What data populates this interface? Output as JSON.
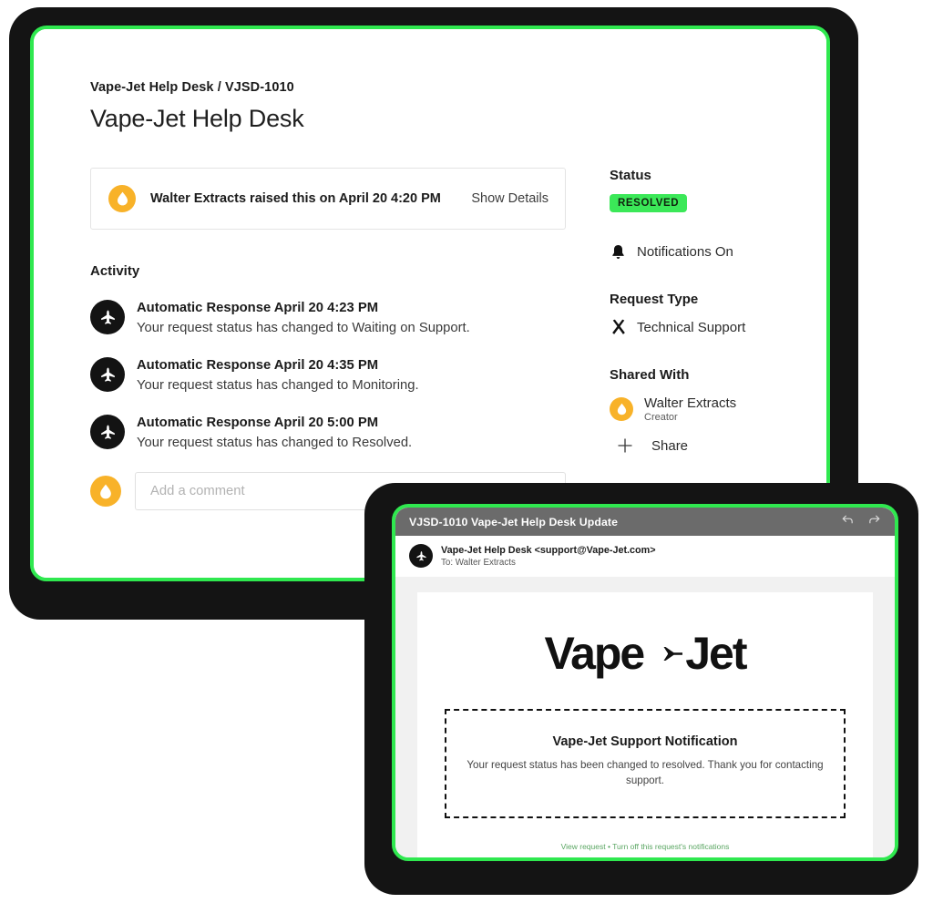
{
  "theme": {
    "accent_green": "#2FE84F",
    "badge_green": "#3BE858",
    "avatar_amber": "#F8B229",
    "frame_black": "#141414",
    "titlebar_gray": "#6b6b6b",
    "footer_link_green": "#5aa662"
  },
  "main": {
    "breadcrumb": "Vape-Jet Help Desk / VJSD-1010",
    "title": "Vape-Jet Help Desk",
    "raised": {
      "avatar_name": "walter-extracts-avatar",
      "text": "Walter Extracts raised this on April 20 4:20 PM",
      "show_details_label": "Show Details"
    },
    "activity_heading": "Activity",
    "activity": [
      {
        "title": "Automatic Response April 20 4:23 PM",
        "description": "Your request status has changed to Waiting on Support."
      },
      {
        "title": "Automatic Response April 20 4:35 PM",
        "description": "Your request status has changed to Monitoring."
      },
      {
        "title": "Automatic Response April 20 5:00 PM",
        "description": "Your request status has changed to Resolved."
      }
    ],
    "comment": {
      "placeholder": "Add a comment",
      "value": ""
    }
  },
  "sidebar": {
    "status_heading": "Status",
    "status_badge": "RESOLVED",
    "notifications_label": "Notifications On",
    "request_type_heading": "Request Type",
    "request_type_value": "Technical Support",
    "shared_with_heading": "Shared With",
    "shared_person_name": "Walter Extracts",
    "shared_person_role": "Creator",
    "share_label": "Share"
  },
  "email": {
    "window_title": "VJSD-1010 Vape-Jet Help Desk Update",
    "sender": "Vape-Jet Help Desk <support@Vape-Jet.com>",
    "recipient": "To: Walter Extracts",
    "logo_left": "Vape",
    "logo_right": "Jet",
    "notice_title": "Vape-Jet Support Notification",
    "notice_body": "Your request status has been changed to resolved. Thank you for contacting support.",
    "footer": "View request • Turn off this request's notifications"
  }
}
